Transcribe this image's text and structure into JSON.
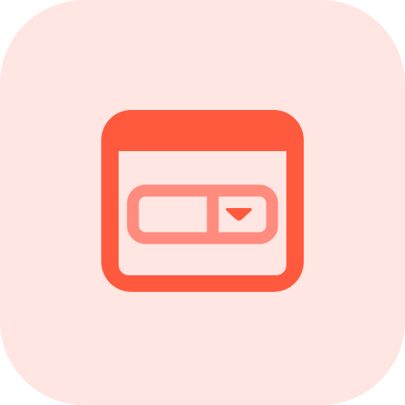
{
  "icon": {
    "name": "browser-window-dropdown-icon",
    "colors": {
      "tile_background": "#FFE6E2",
      "window_primary": "#FF5A3E",
      "dropdown_secondary": "#FF8C7E"
    }
  }
}
